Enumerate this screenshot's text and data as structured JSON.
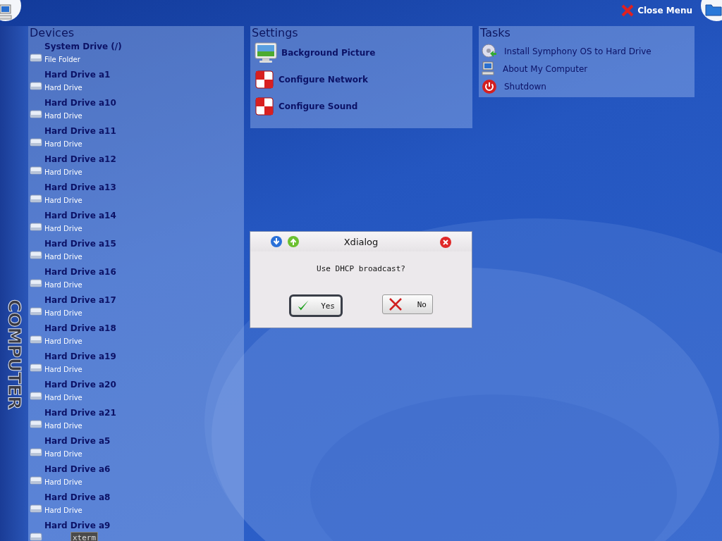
{
  "top_bar": {
    "close_menu": "Close Menu"
  },
  "side_label": "COMPUTER",
  "devices": {
    "title": "Devices",
    "items": [
      {
        "name": "System Drive (/)",
        "type": "File Folder"
      },
      {
        "name": "Hard Drive a1",
        "type": "Hard Drive"
      },
      {
        "name": "Hard Drive a10",
        "type": "Hard Drive"
      },
      {
        "name": "Hard Drive a11",
        "type": "Hard Drive"
      },
      {
        "name": "Hard Drive a12",
        "type": "Hard Drive"
      },
      {
        "name": "Hard Drive a13",
        "type": "Hard Drive"
      },
      {
        "name": "Hard Drive a14",
        "type": "Hard Drive"
      },
      {
        "name": "Hard Drive a15",
        "type": "Hard Drive"
      },
      {
        "name": "Hard Drive a16",
        "type": "Hard Drive"
      },
      {
        "name": "Hard Drive a17",
        "type": "Hard Drive"
      },
      {
        "name": "Hard Drive a18",
        "type": "Hard Drive"
      },
      {
        "name": "Hard Drive a19",
        "type": "Hard Drive"
      },
      {
        "name": "Hard Drive a20",
        "type": "Hard Drive"
      },
      {
        "name": "Hard Drive a21",
        "type": "Hard Drive"
      },
      {
        "name": "Hard Drive a5",
        "type": "Hard Drive"
      },
      {
        "name": "Hard Drive a6",
        "type": "Hard Drive"
      },
      {
        "name": "Hard Drive a8",
        "type": "Hard Drive"
      },
      {
        "name": "Hard Drive a9"
      }
    ]
  },
  "settings": {
    "title": "Settings",
    "items": [
      {
        "label": "Background Picture",
        "kind": "monitor"
      },
      {
        "label": "Configure Network",
        "kind": "checker"
      },
      {
        "label": "Configure Sound",
        "kind": "checker"
      }
    ]
  },
  "tasks": {
    "title": "Tasks",
    "items": [
      {
        "label": "Install Symphony OS to Hard Drive",
        "kind": "disc"
      },
      {
        "label": "About My Computer",
        "kind": "computer"
      },
      {
        "label": "Shutdown",
        "kind": "power"
      }
    ]
  },
  "dialog": {
    "title": "Xdialog",
    "message": "Use DHCP broadcast?",
    "buttons": [
      {
        "label": "Yes",
        "kind": "yes",
        "focused": true
      },
      {
        "label": "No",
        "kind": "no",
        "focused": false
      }
    ]
  },
  "tooltip": "xterm"
}
